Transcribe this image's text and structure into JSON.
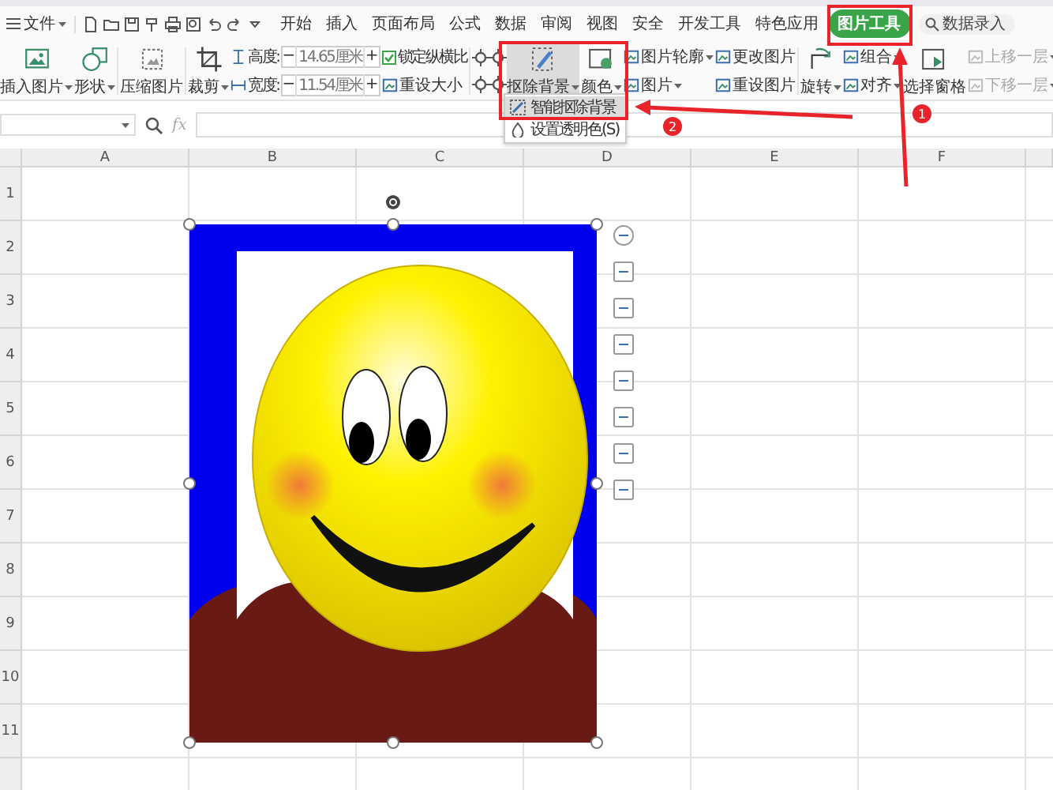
{
  "menu": {
    "file_label": "文件",
    "tabs": [
      {
        "label": "开始",
        "selected": false
      },
      {
        "label": "插入",
        "selected": false
      },
      {
        "label": "页面布局",
        "selected": false
      },
      {
        "label": "公式",
        "selected": false
      },
      {
        "label": "数据",
        "selected": false
      },
      {
        "label": "审阅",
        "selected": false
      },
      {
        "label": "视图",
        "selected": false
      },
      {
        "label": "安全",
        "selected": false
      },
      {
        "label": "开发工具",
        "selected": false
      },
      {
        "label": "特色应用",
        "selected": false
      },
      {
        "label": "图片工具",
        "selected": true
      }
    ],
    "search": {
      "placeholder": "数据录入"
    }
  },
  "ribbon": [
    {
      "kind": "large",
      "label": "插入图片",
      "dropdown": true,
      "pressed": false
    },
    {
      "kind": "large",
      "label": "形状",
      "dropdown": true,
      "pressed": false
    },
    {
      "kind": "large",
      "label": "压缩图片",
      "dropdown": false,
      "pressed": false
    },
    {
      "kind": "large",
      "label": "裁剪",
      "dropdown": true,
      "pressed": false
    },
    {
      "kind": "size",
      "fields": [
        {
          "label": "高度:",
          "value": "14.65厘米",
          "decrement": "−",
          "increment": "+"
        },
        {
          "label": "宽度:",
          "value": "11.54厘米",
          "decrement": "−",
          "increment": "+"
        }
      ]
    },
    {
      "kind": "stack",
      "items": [
        {
          "kind": "checkbox",
          "label": "锁定纵横比",
          "checked": true
        },
        {
          "kind": "button",
          "label": "重设大小",
          "dropdown": false,
          "disabled": false
        }
      ]
    },
    {
      "kind": "icons"
    },
    {
      "kind": "large",
      "label": "抠除背景",
      "dropdown": true,
      "pressed": true
    },
    {
      "kind": "large",
      "label": "颜色",
      "dropdown": true,
      "pressed": false
    },
    {
      "kind": "stack",
      "items": [
        {
          "kind": "button",
          "label": "图片轮廓",
          "dropdown": true,
          "disabled": false
        },
        {
          "kind": "button",
          "label": "图片",
          "dropdown": true,
          "disabled": false
        }
      ]
    },
    {
      "kind": "stack",
      "items": [
        {
          "kind": "button",
          "label": "更改图片",
          "dropdown": false,
          "disabled": false
        },
        {
          "kind": "button",
          "label": "重设图片",
          "dropdown": false,
          "disabled": false
        }
      ]
    },
    {
      "kind": "large",
      "label": "旋转",
      "dropdown": true,
      "pressed": false
    },
    {
      "kind": "stack",
      "items": [
        {
          "kind": "button",
          "label": "组合",
          "dropdown": true,
          "disabled": false
        },
        {
          "kind": "button",
          "label": "对齐",
          "dropdown": true,
          "disabled": false
        }
      ]
    },
    {
      "kind": "large",
      "label": "选择窗格",
      "dropdown": false,
      "pressed": false
    },
    {
      "kind": "stack",
      "items": [
        {
          "kind": "button",
          "label": "上移一层",
          "dropdown": true,
          "disabled": true
        },
        {
          "kind": "button",
          "label": "下移一层",
          "dropdown": true,
          "disabled": true
        }
      ]
    }
  ],
  "dropdown_menu": [
    {
      "label": "智能抠除背景",
      "selected": true
    },
    {
      "label": "设置透明色(S)",
      "selected": false
    }
  ],
  "formula_bar": {
    "function_label": "fx"
  },
  "sheet": {
    "columns": [
      "A",
      "B",
      "C",
      "D",
      "E",
      "F"
    ],
    "rows": [
      "1",
      "2",
      "3",
      "4",
      "5",
      "6",
      "7",
      "8",
      "9",
      "10",
      "11"
    ]
  },
  "annotations": {
    "badges": [
      "1",
      "2"
    ]
  }
}
